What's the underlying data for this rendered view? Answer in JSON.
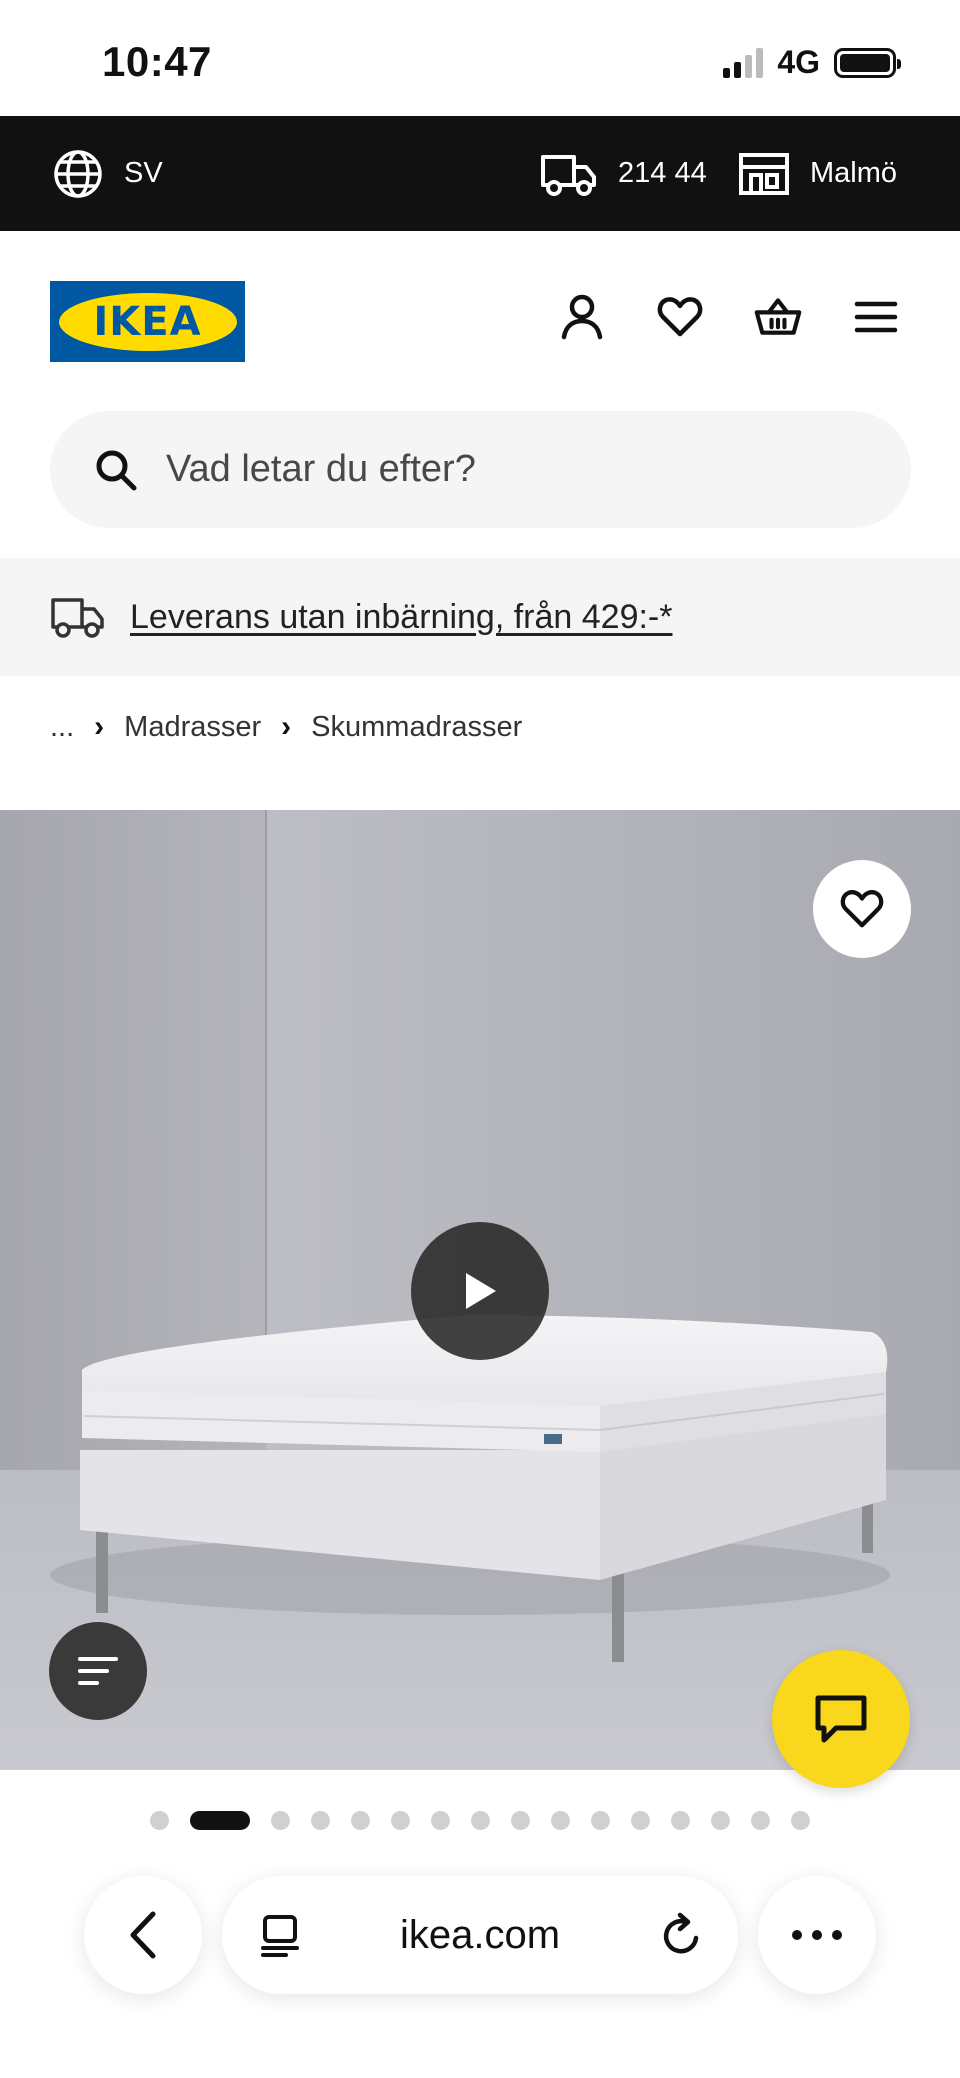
{
  "status_bar": {
    "time": "10:47",
    "network": "4G"
  },
  "topbar": {
    "language": "SV",
    "postal_code": "214 44",
    "store": "Malmö"
  },
  "header": {
    "logo_text": "IKEA"
  },
  "search": {
    "placeholder": "Vad letar du efter?"
  },
  "banner": {
    "text": "Leverans utan inbärning, från 429:-*"
  },
  "breadcrumb": {
    "ellipsis": "...",
    "items": [
      "Madrasser",
      "Skummadrasser"
    ]
  },
  "carousel": {
    "total": 16,
    "active_index": 1
  },
  "browser": {
    "url": "ikea.com"
  },
  "colors": {
    "ikea_blue": "#0058a3",
    "ikea_yellow": "#ffdb00",
    "chat_yellow": "#f9d71c",
    "topbar_bg": "#111111"
  }
}
